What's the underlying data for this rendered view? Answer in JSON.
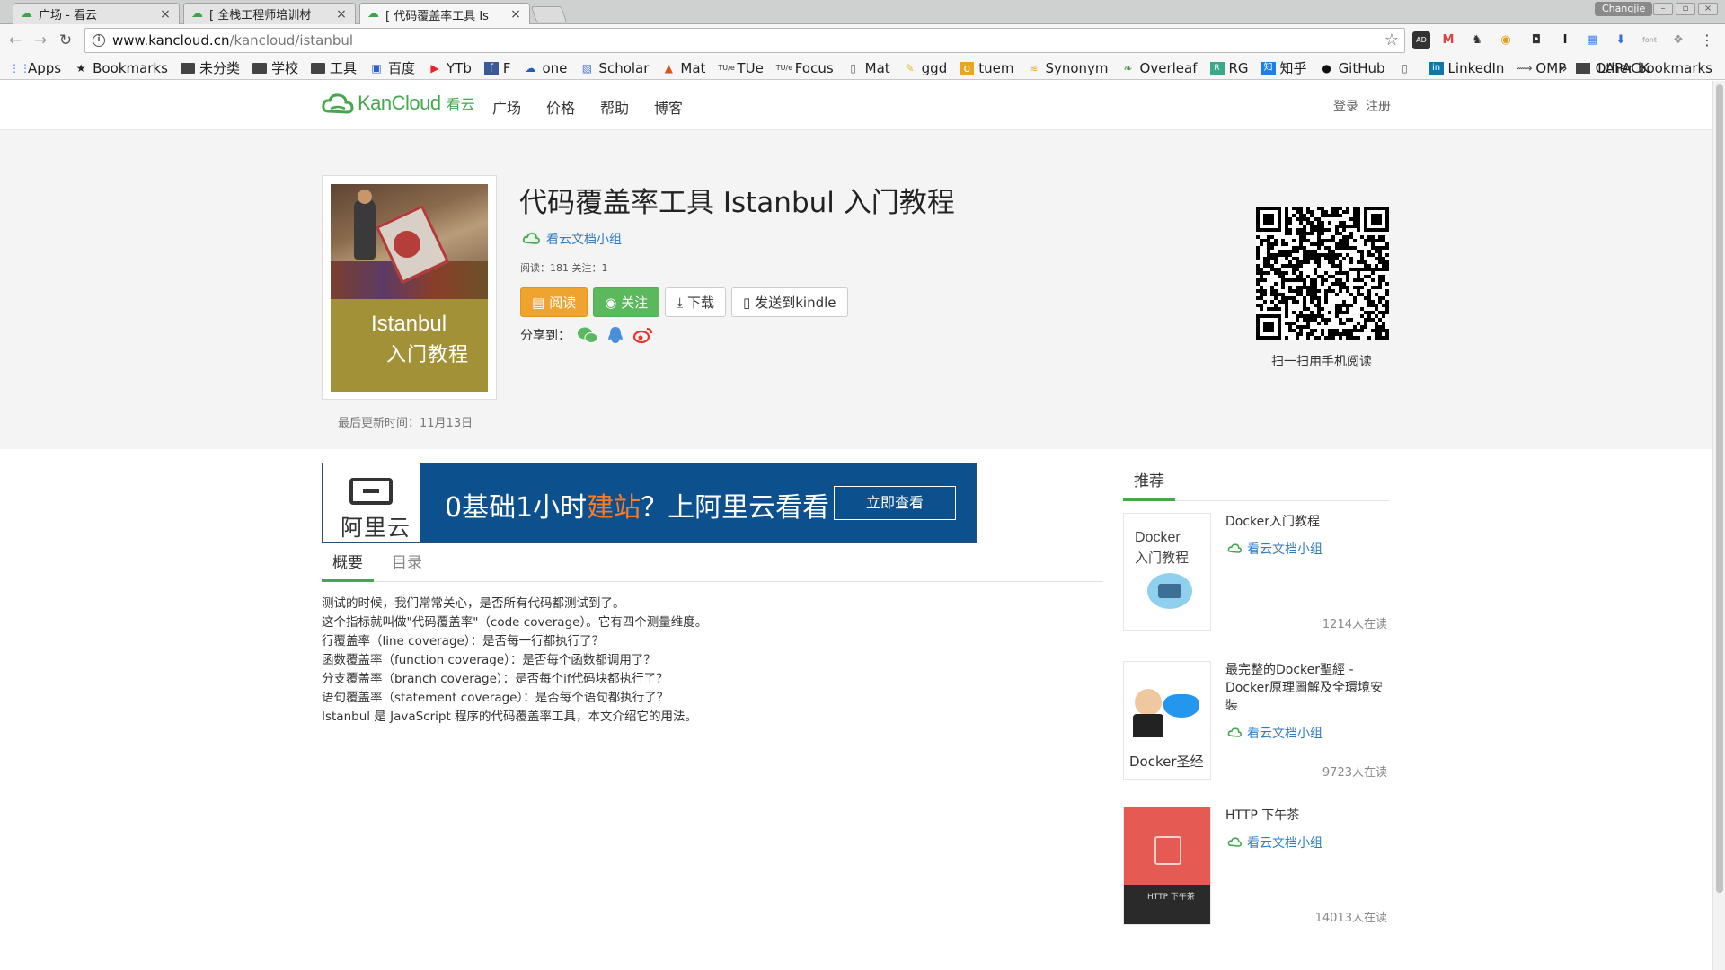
{
  "browser": {
    "tabs": [
      {
        "label": "广场 - 看云",
        "active": false
      },
      {
        "label": "[ 全栈工程师培训材",
        "active": false
      },
      {
        "label": "[ 代码覆盖率工具 Is",
        "active": true
      }
    ],
    "profile": "Changjie",
    "url": {
      "domain": "www.kancloud.cn",
      "path": "/kancloud/istanbul"
    },
    "bookmarks": [
      "Apps",
      "Bookmarks",
      "未分类",
      "学校",
      "工具",
      "百度",
      "YTb",
      "F",
      "one",
      "Scholar",
      "Mat",
      "TUe",
      "Focus",
      "Mat",
      "ggd",
      "tuem",
      "Synonym",
      "Overleaf",
      "RG",
      "知乎",
      "GitHub",
      "",
      "LinkedIn",
      "OMP",
      "LAPACK"
    ],
    "other_bookmarks": "Other bookmarks",
    "overflow": "»"
  },
  "site": {
    "logo_text": "KanCloud",
    "logo_cn": "看云",
    "nav": [
      "广场",
      "价格",
      "帮助",
      "博客"
    ],
    "login": "登录",
    "register": "注册"
  },
  "book": {
    "title": "代码覆盖率工具 Istanbul 入门教程",
    "cover_title_line1": "Istanbul",
    "cover_title_line2": "入门教程",
    "group": "看云文档小组",
    "stats": "阅读：181 关注：1",
    "updated": "最后更新时间：11月13日",
    "actions": {
      "read": "阅读",
      "follow": "关注",
      "download": "下载",
      "kindle": "发送到kindle"
    },
    "share_label": "分享到：",
    "qr_label": "扫一扫用手机阅读"
  },
  "ad": {
    "brand": "阿里云",
    "text_pre": "0基础1小时",
    "text_hl": "建站",
    "text_post": "？上阿里云看看",
    "button": "立即查看"
  },
  "content": {
    "tabs": [
      "概要",
      "目录"
    ],
    "description": [
      "测试的时候，我们常常关心，是否所有代码都测试到了。",
      "这个指标就叫做\"代码覆盖率\"（code coverage）。它有四个测量维度。",
      "行覆盖率（line coverage）：是否每一行都执行了？",
      "函数覆盖率（function coverage）：是否每个函数都调用了？",
      "分支覆盖率（branch coverage）：是否每个if代码块都执行了？",
      "语句覆盖率（statement coverage）：是否每个语句都执行了？",
      "Istanbul 是 JavaScript 程序的代码覆盖率工具，本文介绍它的用法。"
    ]
  },
  "recommend": {
    "heading": "推荐",
    "items": [
      {
        "name": "Docker入门教程",
        "group": "看云文档小组",
        "reads": "1214人在读",
        "cover_line1": "Docker",
        "cover_line2": "入门教程"
      },
      {
        "name": "最完整的Docker聖經 - Docker原理圖解及全環境安裝",
        "group": "看云文档小组",
        "reads": "9723人在读",
        "cover_line1": "Docker圣经"
      },
      {
        "name": "HTTP 下午茶",
        "group": "看云文档小组",
        "reads": "14013人在读",
        "cover_line1": "HTTP 下午茶"
      }
    ]
  }
}
